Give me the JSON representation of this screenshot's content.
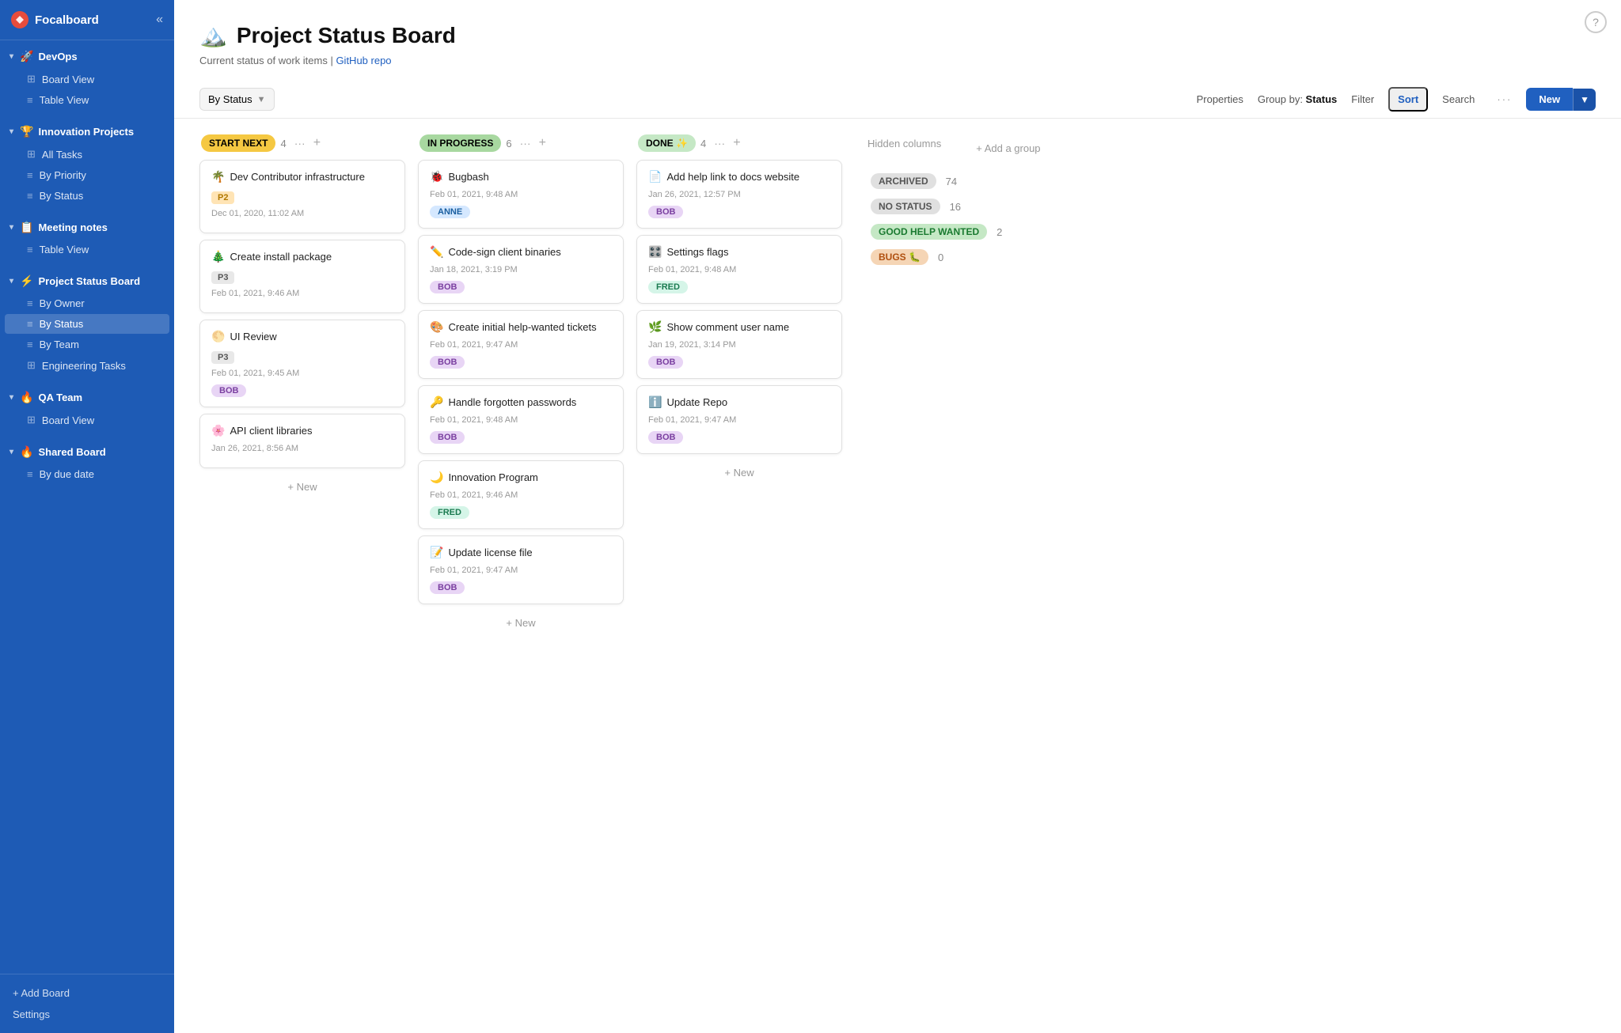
{
  "app": {
    "name": "Focalboard"
  },
  "help_icon": "?",
  "sidebar": {
    "collapse_label": "«",
    "groups": [
      {
        "id": "devops",
        "icon": "🚀",
        "label": "DevOps",
        "items": [
          {
            "id": "board-view-devops",
            "icon": "⊞",
            "label": "Board View"
          },
          {
            "id": "table-view-devops",
            "icon": "≡",
            "label": "Table View"
          }
        ]
      },
      {
        "id": "innovation",
        "icon": "🏆",
        "label": "Innovation Projects",
        "items": [
          {
            "id": "all-tasks",
            "icon": "⊞",
            "label": "All Tasks"
          },
          {
            "id": "by-priority",
            "icon": "≡",
            "label": "By Priority"
          },
          {
            "id": "by-status-innovation",
            "icon": "≡",
            "label": "By Status"
          }
        ]
      },
      {
        "id": "meeting-notes",
        "icon": "📋",
        "label": "Meeting notes",
        "items": [
          {
            "id": "table-view-meeting",
            "icon": "≡",
            "label": "Table View"
          }
        ]
      },
      {
        "id": "project-status",
        "icon": "⚡",
        "label": "Project Status Board",
        "items": [
          {
            "id": "by-owner",
            "icon": "≡",
            "label": "By Owner"
          },
          {
            "id": "by-status-project",
            "icon": "≡",
            "label": "By Status",
            "active": true
          },
          {
            "id": "by-team",
            "icon": "≡",
            "label": "By Team"
          },
          {
            "id": "engineering-tasks",
            "icon": "⊞",
            "label": "Engineering Tasks"
          }
        ]
      },
      {
        "id": "qa-team",
        "icon": "🔥",
        "label": "QA Team",
        "items": [
          {
            "id": "board-view-qa",
            "icon": "⊞",
            "label": "Board View"
          }
        ]
      },
      {
        "id": "shared-board",
        "icon": "🔥",
        "label": "Shared Board",
        "items": [
          {
            "id": "by-due-date",
            "icon": "≡",
            "label": "By due date"
          }
        ]
      }
    ],
    "add_board": "+ Add Board",
    "settings": "Settings"
  },
  "board": {
    "title": "Project Status Board",
    "title_emoji": "🏔️",
    "subtitle": "Current status of work items | ",
    "subtitle_link": "GitHub repo",
    "view_selector": "By Status",
    "toolbar": {
      "properties": "Properties",
      "group_by_label": "Group by: ",
      "group_by_value": "Status",
      "filter": "Filter",
      "sort": "Sort",
      "search": "Search",
      "dots": "···",
      "new": "New"
    },
    "columns": [
      {
        "id": "start-next",
        "title": "START NEXT",
        "badge_class": "badge-start-next",
        "count": 4,
        "cards": [
          {
            "emoji": "🌴",
            "title": "Dev Contributor infrastructure",
            "priority": "P2",
            "priority_class": "priority-p2",
            "date": "Dec 01, 2020, 11:02 AM",
            "assignee": null
          },
          {
            "emoji": "🎄",
            "title": "Create install package",
            "priority": "P3",
            "priority_class": "priority-p3",
            "date": "Feb 01, 2021, 9:46 AM",
            "assignee": null
          },
          {
            "emoji": "🌕",
            "title": "UI Review",
            "priority": "P3",
            "priority_class": "priority-p3",
            "date": "Feb 01, 2021, 9:45 AM",
            "assignee": "BOB",
            "assignee_class": ""
          },
          {
            "emoji": "🌸",
            "title": "API client libraries",
            "priority": null,
            "date": "Jan 26, 2021, 8:56 AM",
            "assignee": null
          }
        ],
        "add_label": "+ New"
      },
      {
        "id": "in-progress",
        "title": "IN PROGRESS",
        "badge_class": "badge-in-progress",
        "count": 6,
        "cards": [
          {
            "emoji": "🐞",
            "title": "Bugbash",
            "priority": null,
            "date": "Feb 01, 2021, 9:48 AM",
            "assignee": "ANNE",
            "assignee_class": "anne"
          },
          {
            "emoji": "✏️",
            "title": "Code-sign client binaries",
            "priority": null,
            "date": "Jan 18, 2021, 3:19 PM",
            "assignee": "BOB",
            "assignee_class": ""
          },
          {
            "emoji": "🎨",
            "title": "Create initial help-wanted tickets",
            "priority": null,
            "date": "Feb 01, 2021, 9:47 AM",
            "assignee": "BOB",
            "assignee_class": ""
          },
          {
            "emoji": "🔑",
            "title": "Handle forgotten passwords",
            "priority": null,
            "date": "Feb 01, 2021, 9:48 AM",
            "assignee": "BOB",
            "assignee_class": ""
          },
          {
            "emoji": "🌙",
            "title": "Innovation Program",
            "priority": null,
            "date": "Feb 01, 2021, 9:46 AM",
            "assignee": "FRED",
            "assignee_class": "fred"
          },
          {
            "emoji": "📝",
            "title": "Update license file",
            "priority": null,
            "date": "Feb 01, 2021, 9:47 AM",
            "assignee": "BOB",
            "assignee_class": ""
          }
        ],
        "add_label": "+ New"
      },
      {
        "id": "done",
        "title": "DONE ✨",
        "badge_class": "badge-done",
        "count": 4,
        "cards": [
          {
            "emoji": "📄",
            "title": "Add help link to docs website",
            "priority": null,
            "date": "Jan 26, 2021, 12:57 PM",
            "assignee": "BOB",
            "assignee_class": ""
          },
          {
            "emoji": "🎛️",
            "title": "Settings flags",
            "priority": null,
            "date": "Feb 01, 2021, 9:48 AM",
            "assignee": "FRED",
            "assignee_class": "fred"
          },
          {
            "emoji": "🌿",
            "title": "Show comment user name",
            "priority": null,
            "date": "Jan 19, 2021, 3:14 PM",
            "assignee": "BOB",
            "assignee_class": ""
          },
          {
            "emoji": "ℹ️",
            "title": "Update Repo",
            "priority": null,
            "date": "Feb 01, 2021, 9:47 AM",
            "assignee": "BOB",
            "assignee_class": ""
          }
        ],
        "add_label": "+ New"
      }
    ],
    "hidden_columns": {
      "title": "Hidden columns",
      "add_group": "+ Add a group",
      "items": [
        {
          "label": "ARCHIVED",
          "badge_class": "badge-archived",
          "count": "74"
        },
        {
          "label": "NO STATUS",
          "badge_class": "badge-no-status",
          "count": "16"
        },
        {
          "label": "GOOD HELP WANTED",
          "badge_class": "badge-good-help",
          "count": "2"
        },
        {
          "label": "BUGS 🐛",
          "badge_class": "badge-bugs",
          "count": "0"
        }
      ]
    }
  }
}
